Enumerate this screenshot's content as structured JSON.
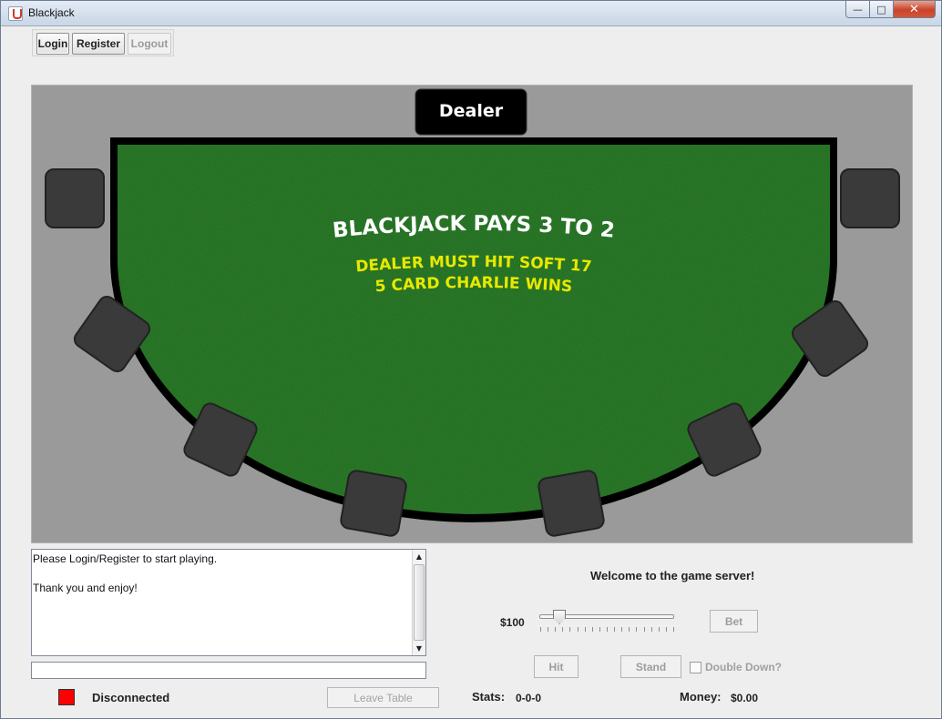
{
  "window": {
    "title": "Blackjack",
    "icon": "java-icon"
  },
  "toolbar": {
    "login_label": "Login",
    "register_label": "Register",
    "logout_label": "Logout"
  },
  "table": {
    "dealer_label": "Dealer",
    "banner_line1": "BLACKJACK PAYS 3 TO 2",
    "banner_line2": "DEALER MUST HIT SOFT 17",
    "banner_line3": "5 CARD CHARLIE WINS",
    "felt_color": "#1f6b1d",
    "banner_main_color": "#ffffff",
    "banner_rule_color": "#e8e800"
  },
  "chat": {
    "lines": [
      "Please Login/Register to start playing.",
      "",
      "Thank you and enjoy!"
    ],
    "input_value": ""
  },
  "status": {
    "text": "Disconnected",
    "color": "#ff0000"
  },
  "controls": {
    "welcome": "Welcome to the game server!",
    "bet_amount": "$100",
    "bet_slider_fraction": 0.1,
    "bet_label": "Bet",
    "hit_label": "Hit",
    "stand_label": "Stand",
    "double_down_label": "Double Down?",
    "double_down_checked": false,
    "leave_label": "Leave Table"
  },
  "stats": {
    "label": "Stats:",
    "value": "0-0-0"
  },
  "money": {
    "label": "Money:",
    "value": "$0.00"
  }
}
